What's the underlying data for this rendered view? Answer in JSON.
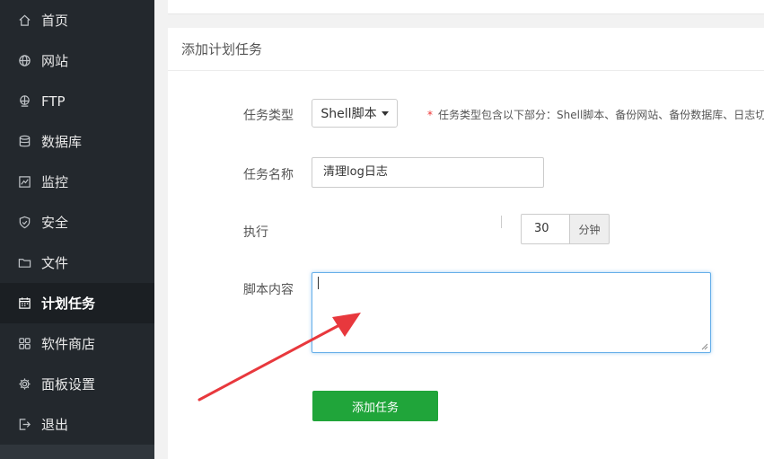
{
  "sidebar": {
    "items": [
      {
        "label": "首页",
        "icon": "home-icon"
      },
      {
        "label": "网站",
        "icon": "globe-icon"
      },
      {
        "label": "FTP",
        "icon": "ftp-icon"
      },
      {
        "label": "数据库",
        "icon": "database-icon"
      },
      {
        "label": "监控",
        "icon": "monitor-icon"
      },
      {
        "label": "安全",
        "icon": "shield-icon"
      },
      {
        "label": "文件",
        "icon": "folder-icon"
      },
      {
        "label": "计划任务",
        "icon": "calendar-icon",
        "active": true
      },
      {
        "label": "软件商店",
        "icon": "grid-icon"
      },
      {
        "label": "面板设置",
        "icon": "gear-icon"
      },
      {
        "label": "退出",
        "icon": "logout-icon"
      }
    ]
  },
  "card": {
    "title": "添加计划任务"
  },
  "form": {
    "task_type_label": "任务类型",
    "task_type_value": "Shell脚本",
    "task_type_hint": "任务类型包含以下部分：Shell脚本、备份网站、备份数据库、日志切",
    "task_name_label": "任务名称",
    "task_name_value": "清理log日志",
    "execute_label": "执行",
    "minutes_value": "30",
    "minutes_unit": "分钟",
    "script_label": "脚本内容",
    "script_value": "",
    "submit_label": "添加任务"
  },
  "colors": {
    "sidebar_bg": "#23282d",
    "accent_green": "#20a53a",
    "arrow_red": "#e8383d",
    "focus_blue": "#66afe9"
  }
}
